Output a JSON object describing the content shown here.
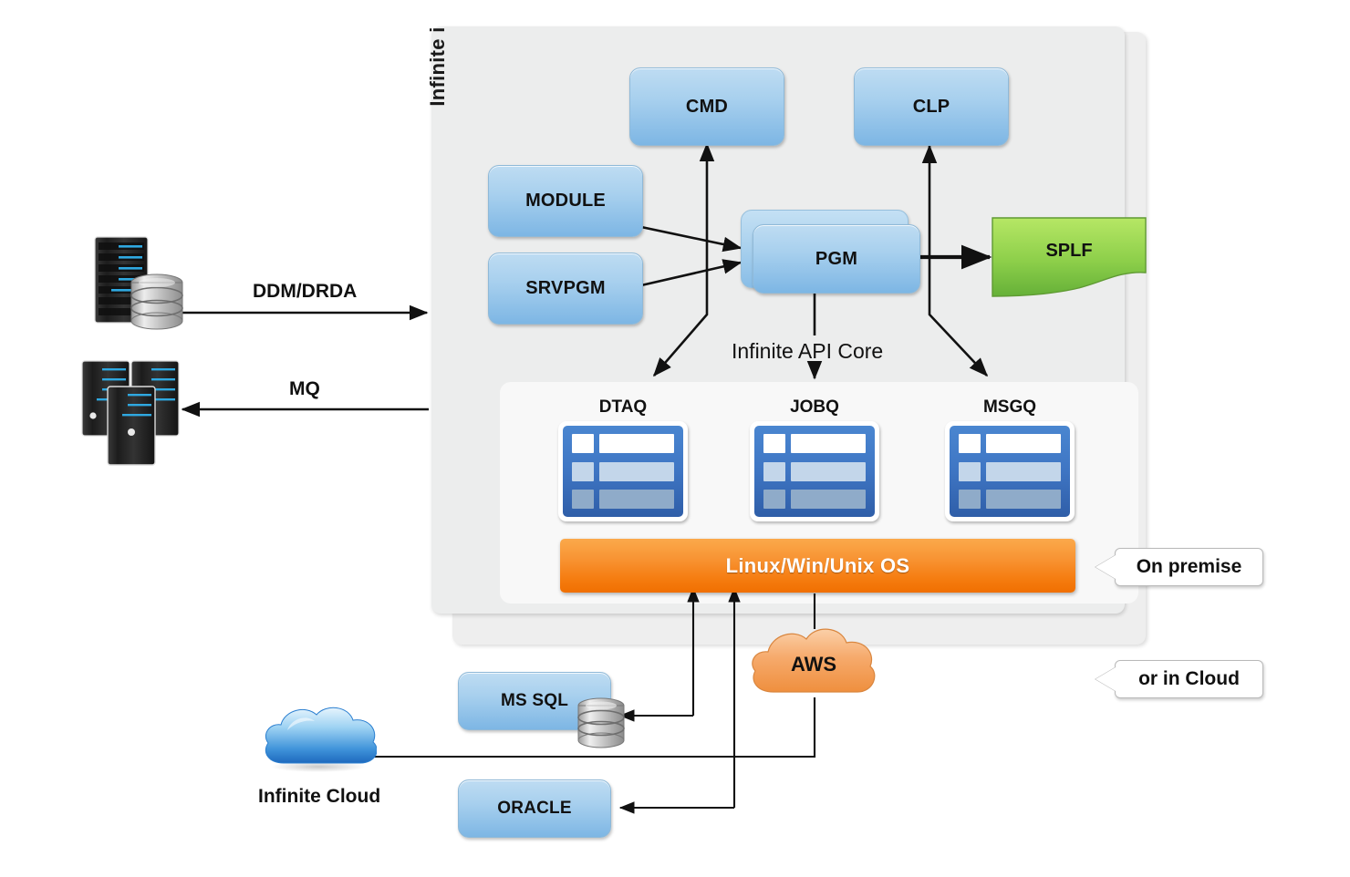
{
  "diagram": {
    "vertical_label": "Infinite i",
    "core_label": "Infinite API Core"
  },
  "boxes": {
    "cmd": "CMD",
    "clp": "CLP",
    "module": "MODULE",
    "srvpgm": "SRVPGM",
    "pgm": "PGM",
    "splf": "SPLF",
    "ms_sql": "MS SQL",
    "oracle": "ORACLE"
  },
  "queues": [
    {
      "label": "DTAQ"
    },
    {
      "label": "JOBQ"
    },
    {
      "label": "MSGQ"
    }
  ],
  "os_bar": {
    "label": "Linux/Win/Unix OS"
  },
  "callouts": {
    "on_premise": "On premise",
    "or_in_cloud": "or in Cloud"
  },
  "connections": {
    "ddm_drda": "DDM/DRDA",
    "mq": "MQ"
  },
  "clouds": {
    "aws": "AWS",
    "infinite_cloud_caption": "Infinite Cloud"
  },
  "colors": {
    "panel_back": "#eeeeee",
    "panel_front": "#eceded",
    "panel_inner": "#f8f8f8",
    "box_blue_top": "#bedcf2",
    "box_blue_bottom": "#7db6e4",
    "splf_green_top": "#aee05a",
    "splf_green_bottom": "#6db83c",
    "queue_blue": "#3f76c4",
    "os_orange_top": "#fba94b",
    "os_orange_bottom": "#f06f00",
    "aws_cloud_top": "#f8c08a",
    "aws_cloud_bottom": "#f0944a",
    "infinite_cloud_top": "#cfeaf8",
    "infinite_cloud_bottom": "#2b7fd0",
    "server_dark": "#2a2a2a",
    "server_stripe": "#2fa8e0",
    "db_silver": "#cfcfcf",
    "line": "#111111"
  }
}
